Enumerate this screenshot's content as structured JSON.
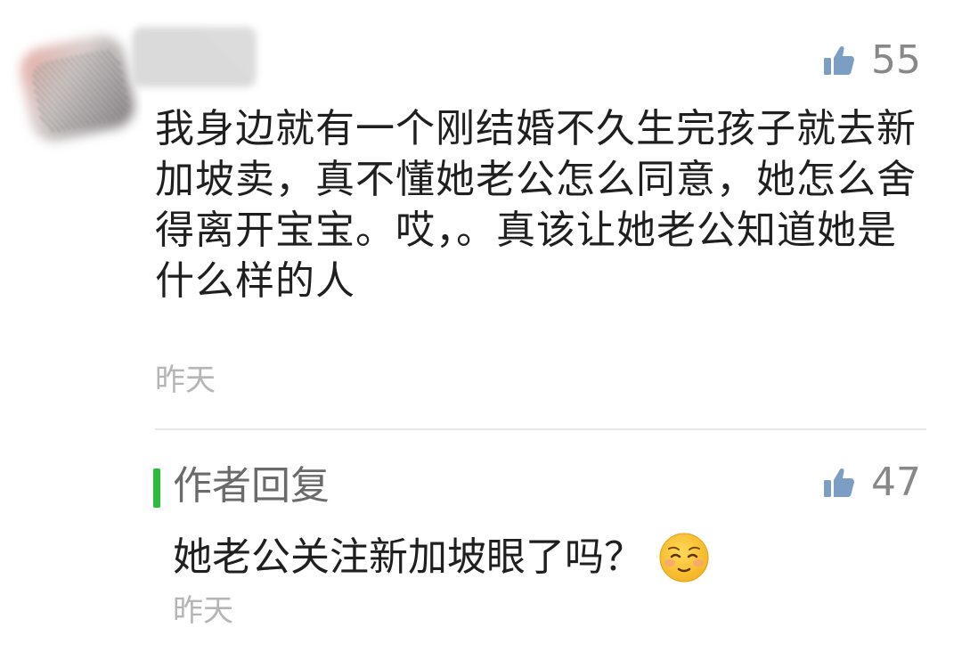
{
  "comment": {
    "likes": "55",
    "text": "我身边就有一个刚结婚不久生完孩子就去新加坡卖，真不懂她老公怎么同意，她怎么舍得离开宝宝。哎，。真该让她老公知道她是什么样的人",
    "time": "昨天"
  },
  "reply": {
    "label": "作者回复",
    "likes": "47",
    "text": "她老公关注新加坡眼了吗？",
    "time": "昨天"
  },
  "icons": {
    "like": "thumbs-up-icon",
    "emoji": "pleading-face-icon"
  },
  "colors": {
    "accent": "#2dbb3e",
    "like_icon": "#7d9ec4",
    "muted_text": "#888888",
    "time_text": "#b5b5b5"
  }
}
